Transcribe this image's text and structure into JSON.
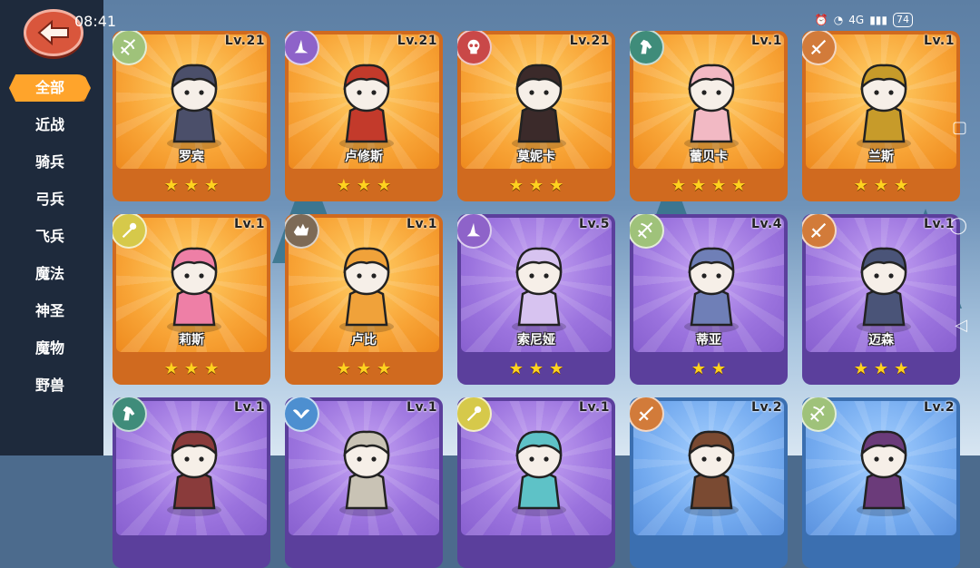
{
  "status_bar": {
    "time": "08:41",
    "network": "4G",
    "battery": "74"
  },
  "sidebar": {
    "items": [
      {
        "label": "全部",
        "active": true
      },
      {
        "label": "近战"
      },
      {
        "label": "骑兵"
      },
      {
        "label": "弓兵"
      },
      {
        "label": "飞兵"
      },
      {
        "label": "魔法"
      },
      {
        "label": "神圣"
      },
      {
        "label": "魔物"
      },
      {
        "label": "野兽"
      }
    ]
  },
  "colors": {
    "orange": "#d06a1f",
    "purple": "#5b3f9c",
    "blue": "#3b6fb0",
    "star": "#ffd21f",
    "accent": "#ffa42b"
  },
  "heroes": [
    {
      "name": "罗宾",
      "level": "Lv.21",
      "stars": 3,
      "rarity": "orange",
      "class_icon": "crossbow-icon",
      "badge_color": "#9fc27a",
      "char_color": "#4b4f6a"
    },
    {
      "name": "卢修斯",
      "level": "Lv.21",
      "stars": 3,
      "rarity": "orange",
      "class_icon": "wizard-hat-icon",
      "badge_color": "#8e63c9",
      "char_color": "#c33a2b"
    },
    {
      "name": "莫妮卡",
      "level": "Lv.21",
      "stars": 3,
      "rarity": "orange",
      "class_icon": "skull-icon",
      "badge_color": "#c94848",
      "char_color": "#3b2a2a"
    },
    {
      "name": "蕾贝卡",
      "level": "Lv.1",
      "stars": 4,
      "rarity": "orange",
      "class_icon": "horse-icon",
      "badge_color": "#3f8c7a",
      "char_color": "#f2b9c4"
    },
    {
      "name": "兰斯",
      "level": "Lv.1",
      "stars": 3,
      "rarity": "orange",
      "class_icon": "sword-icon",
      "badge_color": "#d27b3a",
      "char_color": "#c79b2a"
    },
    {
      "name": "莉斯",
      "level": "Lv.1",
      "stars": 3,
      "rarity": "orange",
      "class_icon": "staff-icon",
      "badge_color": "#d6c94a",
      "char_color": "#ee7fa6"
    },
    {
      "name": "卢比",
      "level": "Lv.1",
      "stars": 3,
      "rarity": "orange",
      "class_icon": "beast-icon",
      "badge_color": "#7d6a56",
      "char_color": "#f0a23a"
    },
    {
      "name": "索尼娅",
      "level": "Lv.5",
      "stars": 3,
      "rarity": "purple",
      "class_icon": "wizard-hat-icon",
      "badge_color": "#8e63c9",
      "char_color": "#d7c3f0"
    },
    {
      "name": "蒂亚",
      "level": "Lv.4",
      "stars": 2,
      "rarity": "purple",
      "class_icon": "crossbow-icon",
      "badge_color": "#9fc27a",
      "char_color": "#6f7fb7"
    },
    {
      "name": "迈森",
      "level": "Lv.1",
      "stars": 3,
      "rarity": "purple",
      "class_icon": "sword-icon",
      "badge_color": "#d27b3a",
      "char_color": "#4a5478"
    },
    {
      "name": "",
      "level": "Lv.1",
      "stars": 0,
      "rarity": "purple",
      "class_icon": "horse-icon",
      "badge_color": "#3f8c7a",
      "char_color": "#8a3b3b"
    },
    {
      "name": "",
      "level": "Lv.1",
      "stars": 0,
      "rarity": "purple",
      "class_icon": "wings-icon",
      "badge_color": "#4d8fd0",
      "char_color": "#c9c3b5"
    },
    {
      "name": "",
      "level": "Lv.1",
      "stars": 0,
      "rarity": "purple",
      "class_icon": "staff-icon",
      "badge_color": "#d6c94a",
      "char_color": "#5ec2c7"
    },
    {
      "name": "",
      "level": "Lv.2",
      "stars": 0,
      "rarity": "blue",
      "class_icon": "sword-icon",
      "badge_color": "#d27b3a",
      "char_color": "#7a4a32"
    },
    {
      "name": "",
      "level": "Lv.2",
      "stars": 0,
      "rarity": "blue",
      "class_icon": "crossbow-icon",
      "badge_color": "#9fc27a",
      "char_color": "#6b3b7a"
    }
  ]
}
